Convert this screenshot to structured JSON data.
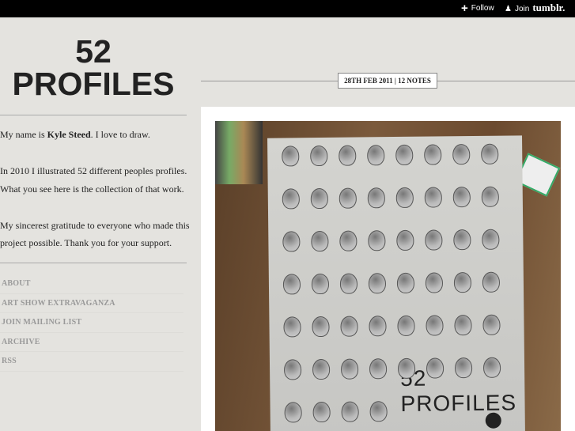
{
  "topbar": {
    "follow": "Follow",
    "join": "Join",
    "brand": "tumblr."
  },
  "blog": {
    "title_line1": "52",
    "title_line2": "PROFILES"
  },
  "intro": {
    "p1_prefix": "My name is ",
    "p1_name": "Kyle Steed",
    "p1_suffix": ". I love to draw.",
    "p2_line1": "In 2010 I illustrated 52 different peoples profiles.",
    "p2_line2": "What you see here is the collection of that work.",
    "p3_line1": "My sincerest gratitude to everyone who made this",
    "p3_line2": "project possible. Thank you for your support."
  },
  "nav": [
    "ABOUT",
    "ART SHOW EXTRAVAGANZA",
    "JOIN MAILING LIST",
    "ARCHIVE",
    "RSS"
  ],
  "post": {
    "date_notes": "28TH FEB 2011 | 12 NOTES",
    "photo_caption": "52 PROFILES"
  }
}
